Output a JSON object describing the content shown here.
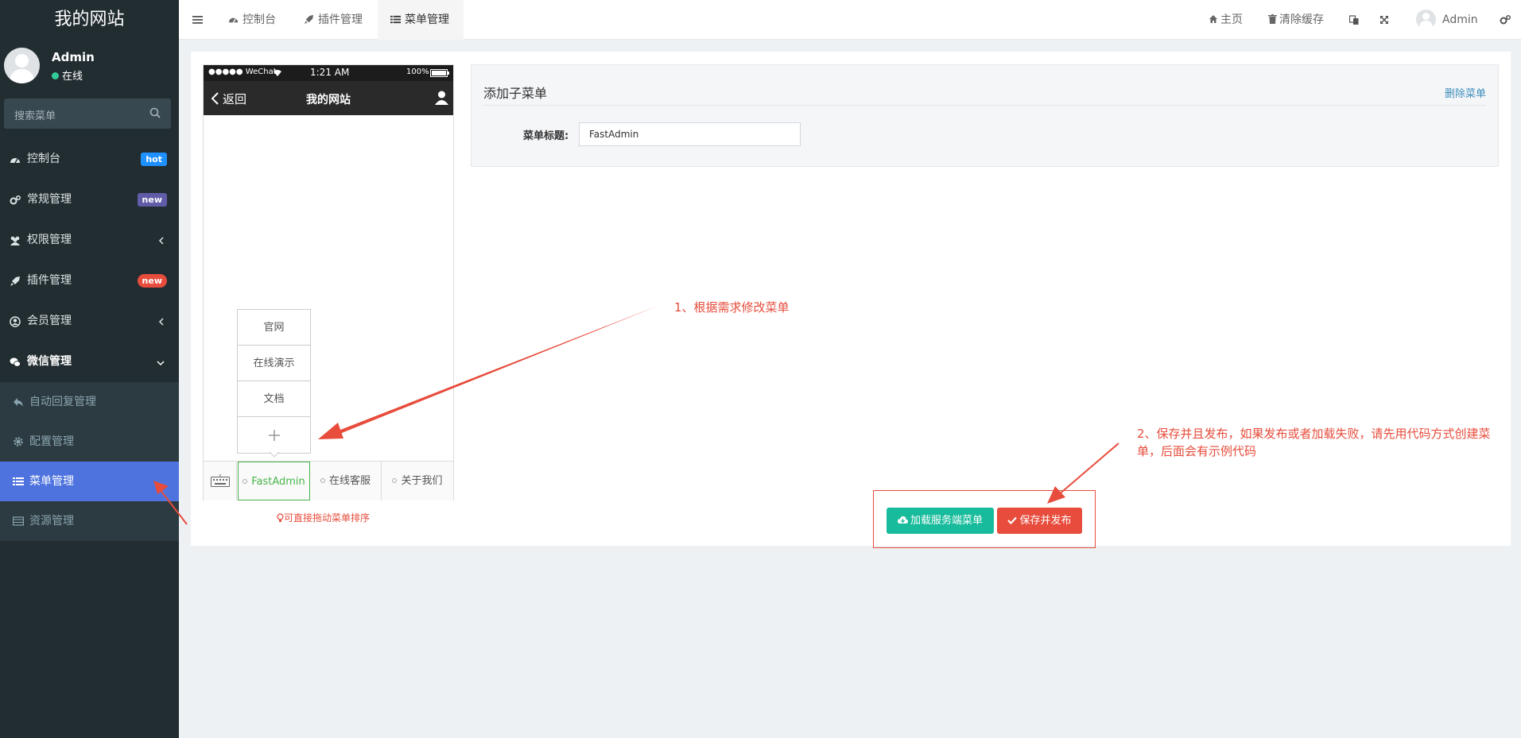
{
  "sidebar": {
    "logo": "我的网站",
    "user": {
      "name": "Admin",
      "status": "在线"
    },
    "search_placeholder": "搜索菜单",
    "items": [
      {
        "label": "控制台",
        "badge": "hot",
        "badge_color": "#1e90ff"
      },
      {
        "label": "常规管理",
        "badge": "new",
        "badge_color": "#605ca8"
      },
      {
        "label": "权限管理"
      },
      {
        "label": "插件管理",
        "badge": "new",
        "badge_color": "#e74c3c"
      },
      {
        "label": "会员管理"
      },
      {
        "label": "微信管理"
      }
    ],
    "sub_items": [
      {
        "label": "自动回复管理"
      },
      {
        "label": "配置管理"
      },
      {
        "label": "菜单管理"
      },
      {
        "label": "资源管理"
      }
    ]
  },
  "topbar": {
    "tabs": [
      {
        "label": "控制台"
      },
      {
        "label": "插件管理"
      },
      {
        "label": "菜单管理"
      }
    ],
    "home": "主页",
    "clear_cache": "清除缓存",
    "user": "Admin"
  },
  "phone": {
    "carrier": "●●●●● WeChat",
    "time": "1:21 AM",
    "battery": "100%",
    "back": "返回",
    "title": "我的网站",
    "submenu": [
      "官网",
      "在线演示",
      "文档"
    ],
    "tabs": [
      "FastAdmin",
      "在线客服",
      "关于我们"
    ],
    "drag_hint": "可直接拖动菜单排序"
  },
  "form": {
    "title": "添加子菜单",
    "delete": "删除菜单",
    "label": "菜单标题:",
    "value": "FastAdmin"
  },
  "buttons": {
    "load": "加载服务端菜单",
    "save": "保存并发布"
  },
  "annotations": {
    "note1": "1、根据需求修改菜单",
    "note2_line1": "2、保存并且发布，如果发布或者加载失败，请先用代码方式创建菜",
    "note2_line2": "单，后面会有示例代码"
  },
  "colors": {
    "sidebar_bg": "#222d32",
    "active": "#4e73df",
    "success": "#18bc9c",
    "danger": "#e74c3c",
    "tab_active": "#46b549"
  }
}
